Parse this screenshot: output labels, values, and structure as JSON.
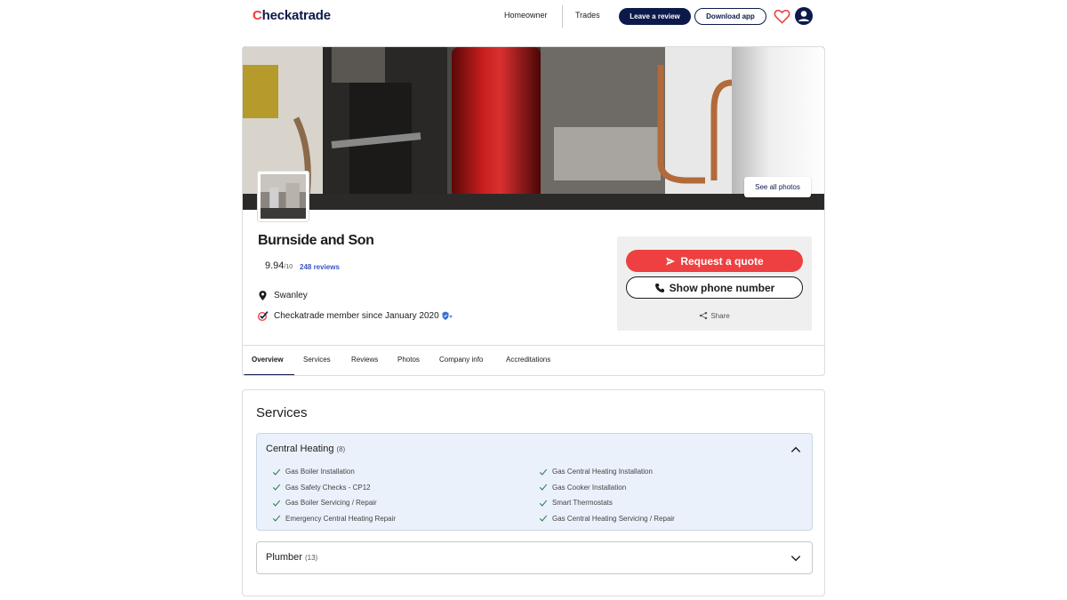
{
  "header": {
    "logo_prefix": "C",
    "logo_mid": "hecka",
    "logo_suffix": "trade",
    "nav": [
      "Homeowner",
      "Trades"
    ],
    "leave_review": "Leave a review",
    "download_app": "Download app"
  },
  "profile": {
    "see_all_photos": "See all photos",
    "name": "Burnside and Son",
    "rating": "9.94",
    "rating_scale": "/10",
    "reviews": "248 reviews",
    "location": "Swanley",
    "member_since": "Checkatrade member since January 2020",
    "request_quote": "Request a quote",
    "show_phone": "Show phone number",
    "share": "Share",
    "tabs": [
      "Overview",
      "Services",
      "Reviews",
      "Photos",
      "Company info",
      "Accreditations"
    ]
  },
  "services": {
    "title": "Services",
    "groups": [
      {
        "name": "Central Heating",
        "count": "(8)",
        "expanded": true,
        "left": [
          "Gas Boiler Installation",
          "Gas Safety Checks - CP12",
          "Gas Boiler Servicing / Repair",
          "Emergency Central Heating Repair"
        ],
        "right": [
          "Gas Central Heating Installation",
          "Gas Cooker Installation",
          "Smart Thermostats",
          "Gas Central Heating Servicing / Repair"
        ]
      },
      {
        "name": "Plumber",
        "count": "(13)",
        "expanded": false
      }
    ]
  },
  "colors": {
    "brand_navy": "#0c1a4b",
    "brand_red": "#ee4040",
    "link_blue": "#3a55c6",
    "accordion_bg": "#eaf1fa"
  }
}
